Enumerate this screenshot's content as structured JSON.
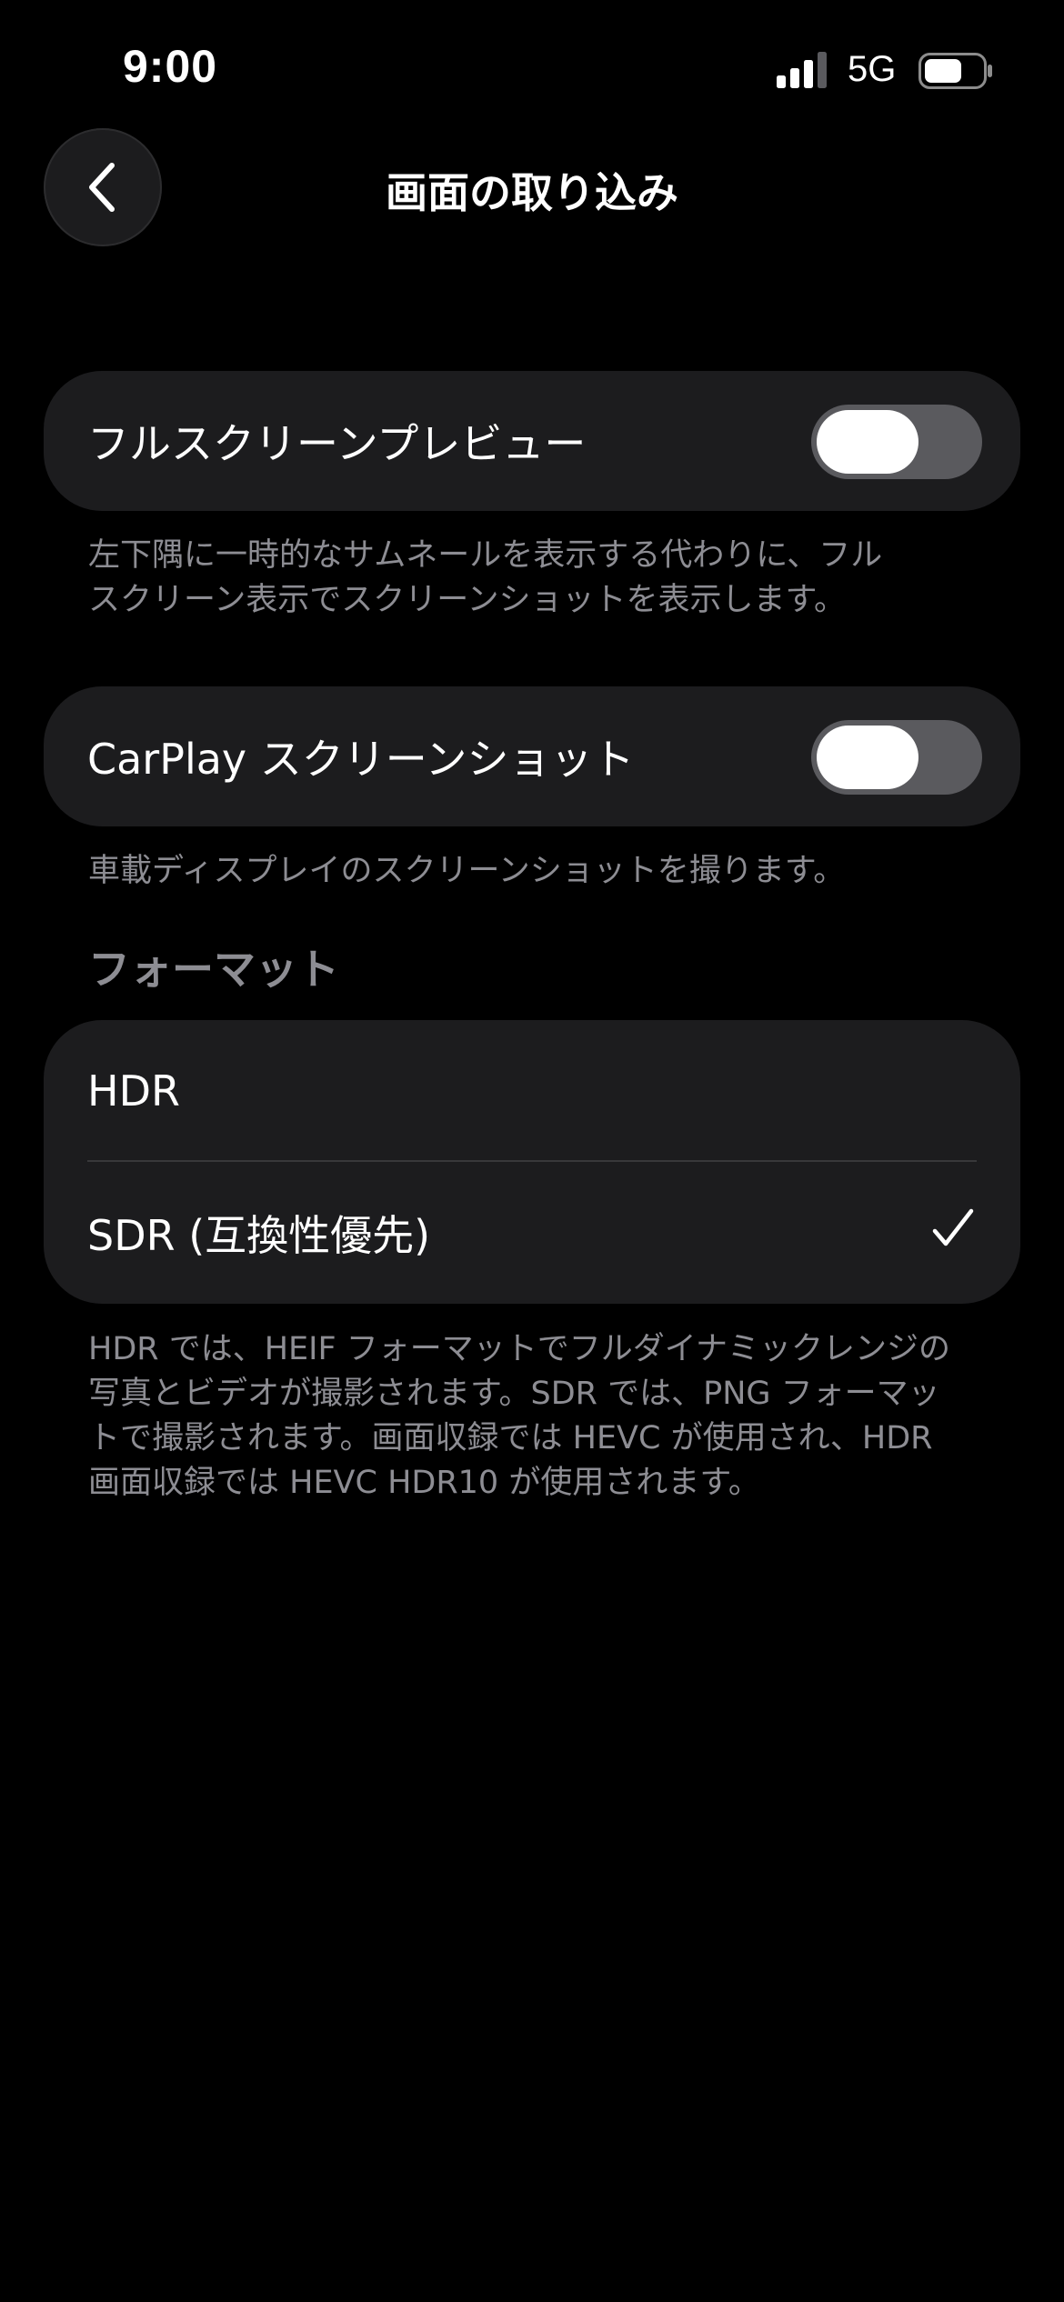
{
  "status_bar": {
    "time": "9:00",
    "network": "5G",
    "signal_icon": "cellular-signal-icon",
    "battery_icon": "battery-icon"
  },
  "nav": {
    "back_icon": "chevron-left-icon",
    "title": "画面の取り込み"
  },
  "fullscreen_preview": {
    "label": "フルスクリーンプレビュー",
    "enabled": true,
    "footnote_line1": "左下隅に一時的なサムネールを表示する代わりに、フル",
    "footnote_line2": "スクリーン表示でスクリーンショットを表示します。"
  },
  "carplay": {
    "label": "CarPlay スクリーンショット",
    "enabled": true,
    "footnote": "車載ディスプレイのスクリーンショットを撮ります。"
  },
  "format": {
    "header": "フォーマット",
    "options": [
      {
        "label": "HDR",
        "selected": false
      },
      {
        "label": "SDR (互換性優先)",
        "selected": true
      }
    ],
    "footnote_lines": [
      "HDR では、HEIF フォーマットでフルダイナミックレンジの",
      "写真とビデオが撮影されます。SDR では、PNG フォーマッ",
      "トで撮影されます。画面収録では HEVC が使用され、HDR",
      "画面収録では HEVC HDR10 が使用されます。"
    ]
  },
  "colors": {
    "background": "#000000",
    "cell": "#1c1c1e",
    "secondary_text": "#8d8d93",
    "toggle_track": "#5a5a5e"
  }
}
